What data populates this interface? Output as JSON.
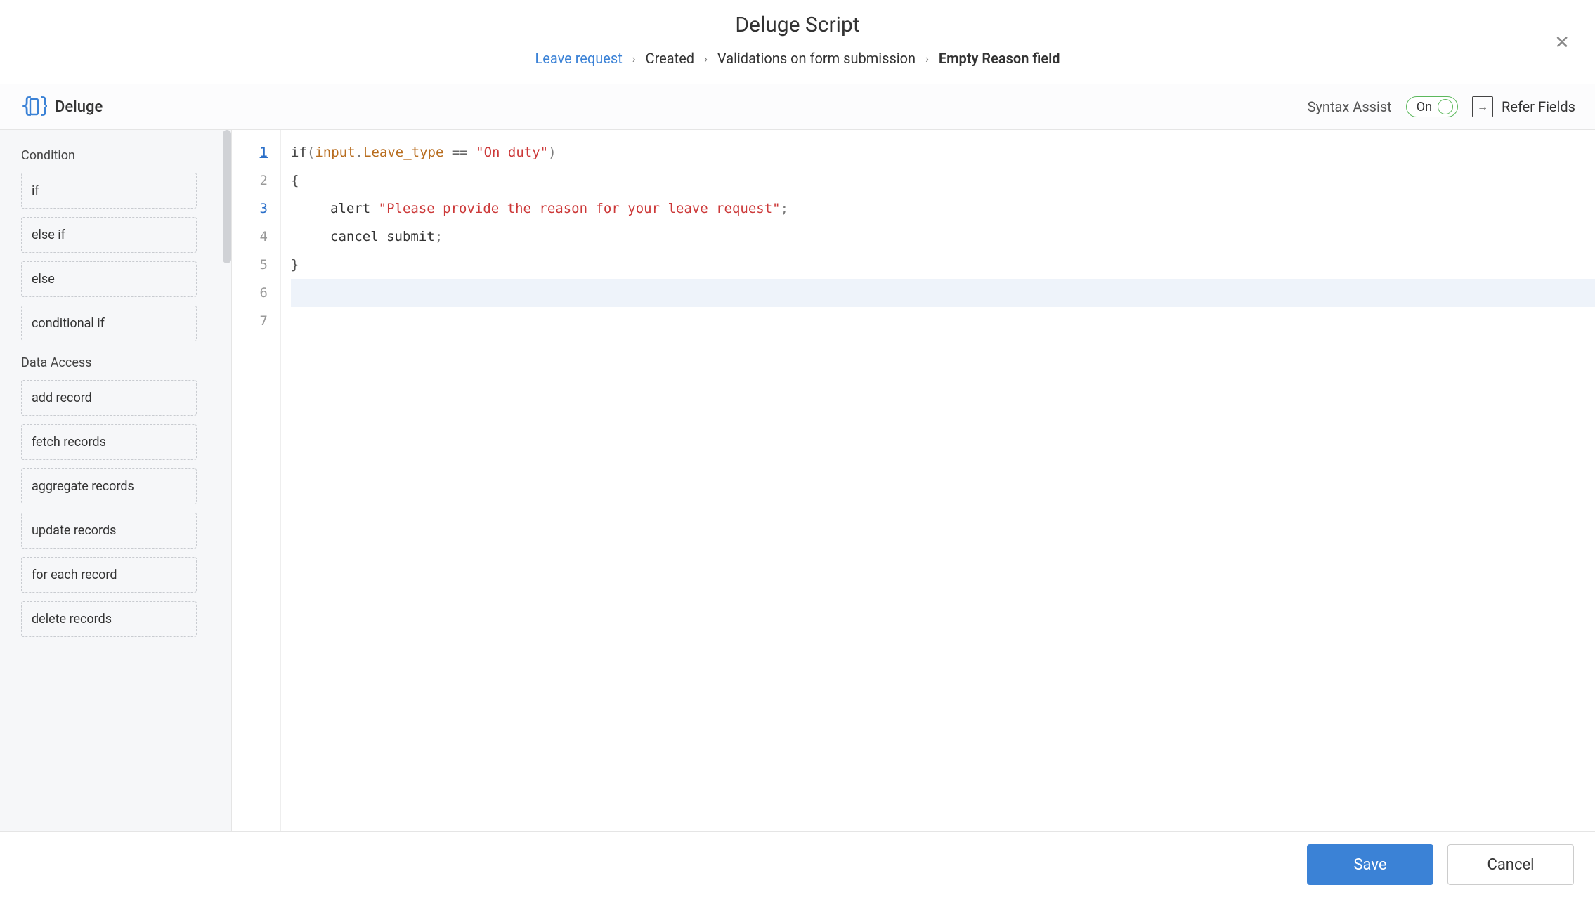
{
  "header": {
    "title": "Deluge Script",
    "breadcrumb": [
      {
        "label": "Leave request",
        "link": true
      },
      {
        "label": "Created"
      },
      {
        "label": "Validations on form submission"
      },
      {
        "label": "Empty Reason field",
        "bold": true
      }
    ]
  },
  "toolbar": {
    "brand": "Deluge",
    "syntax_assist_label": "Syntax Assist",
    "toggle_state": "On",
    "refer_fields": "Refer Fields"
  },
  "sidebar": {
    "categories": [
      {
        "title": "Condition",
        "items": [
          "if",
          "else if",
          "else",
          "conditional if"
        ]
      },
      {
        "title": "Data Access",
        "items": [
          "add record",
          "fetch records",
          "aggregate records",
          "update records",
          "for each record",
          "delete records"
        ]
      }
    ]
  },
  "editor": {
    "line_numbers": [
      1,
      2,
      3,
      4,
      5,
      6,
      7
    ],
    "linked_lines": [
      1,
      3
    ],
    "highlighted_line": 6,
    "code": {
      "l1": {
        "kw": "if",
        "p1": "(",
        "id1": "input",
        "dot": ".",
        "id2": "Leave_type",
        "op": " == ",
        "str": "\"On duty\"",
        "p2": ")"
      },
      "l2": {
        "brace": "{"
      },
      "l3": {
        "stmt": "alert ",
        "str": "\"Please provide the reason for your leave request\"",
        "semi": ";"
      },
      "l4": {
        "stmt": "cancel submit",
        "semi": ";"
      },
      "l5": {
        "brace": "}"
      }
    }
  },
  "footer": {
    "save": "Save",
    "cancel": "Cancel"
  }
}
